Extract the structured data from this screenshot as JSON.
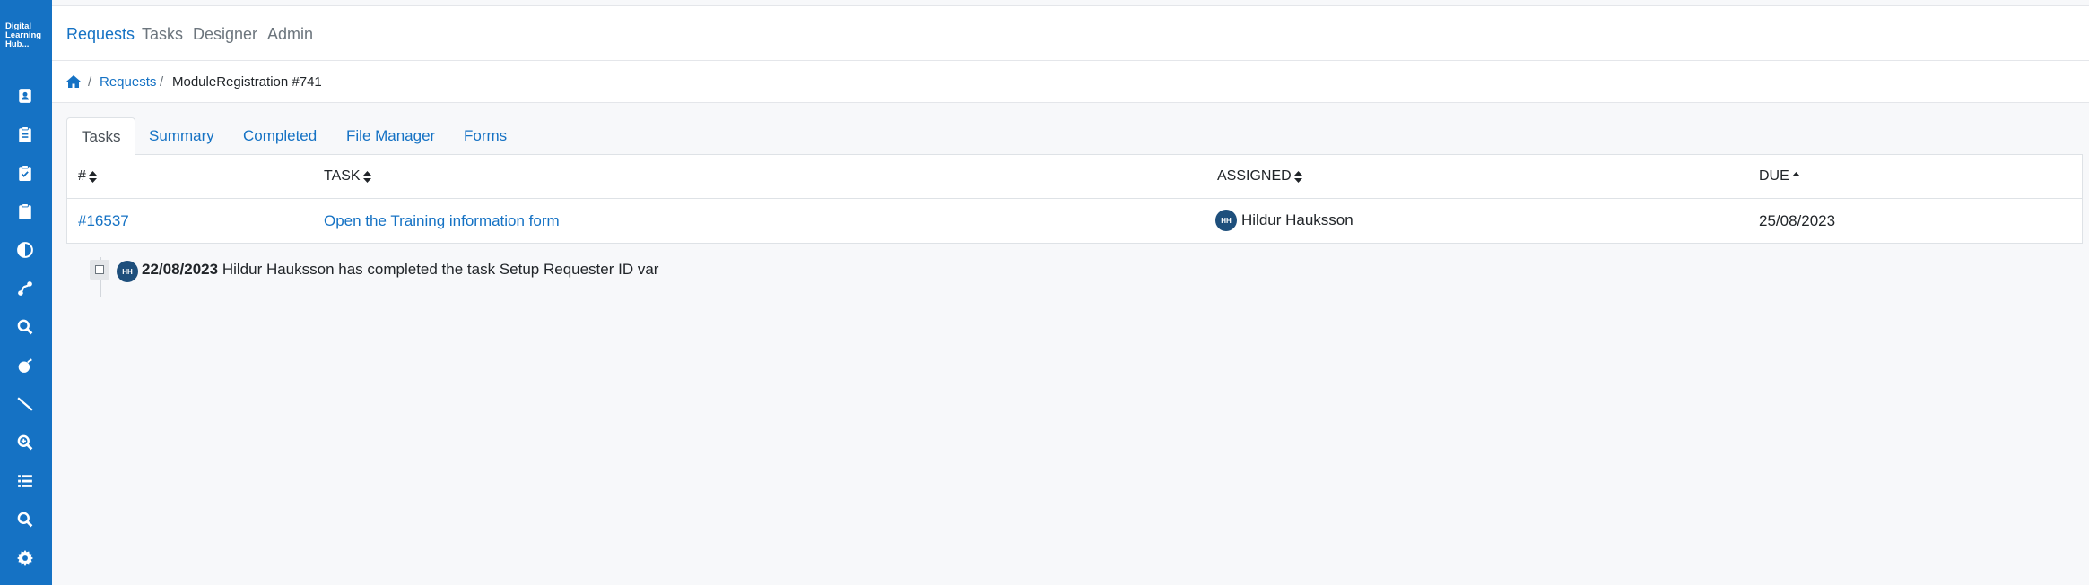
{
  "sidebar": {
    "logo_lines": [
      "Digital",
      "Learning",
      "Hub..."
    ],
    "icons": [
      "contact-book-icon",
      "clipboard-list-icon",
      "clipboard-check-icon",
      "clipboard-icon",
      "contrast-icon",
      "route-icon",
      "search-icon",
      "bomb-icon",
      "line-icon",
      "zoom-in-icon",
      "list-icon",
      "search-icon",
      "gear-icon"
    ]
  },
  "topnav": {
    "items": [
      "Requests",
      "Tasks",
      "Designer",
      "Admin"
    ]
  },
  "breadcrumb": {
    "link": "Requests",
    "separator": "/",
    "current": "ModuleRegistration #741"
  },
  "tabs": [
    "Tasks",
    "Summary",
    "Completed",
    "File Manager",
    "Forms"
  ],
  "table": {
    "headers": [
      "#",
      "TASK",
      "ASSIGNED",
      "DUE"
    ],
    "rows": [
      {
        "id": "#16537",
        "task": "Open the Training information form",
        "assigned_initials": "HH",
        "assigned_name": "Hildur Hauksson",
        "due": "25/08/2023"
      }
    ]
  },
  "timeline": {
    "initials": "HH",
    "date": "22/08/2023",
    "message": "Hildur Hauksson has completed the task Setup Requester ID var"
  },
  "colors": {
    "primary": "#1572c4",
    "avatar": "#1e4f7c"
  }
}
